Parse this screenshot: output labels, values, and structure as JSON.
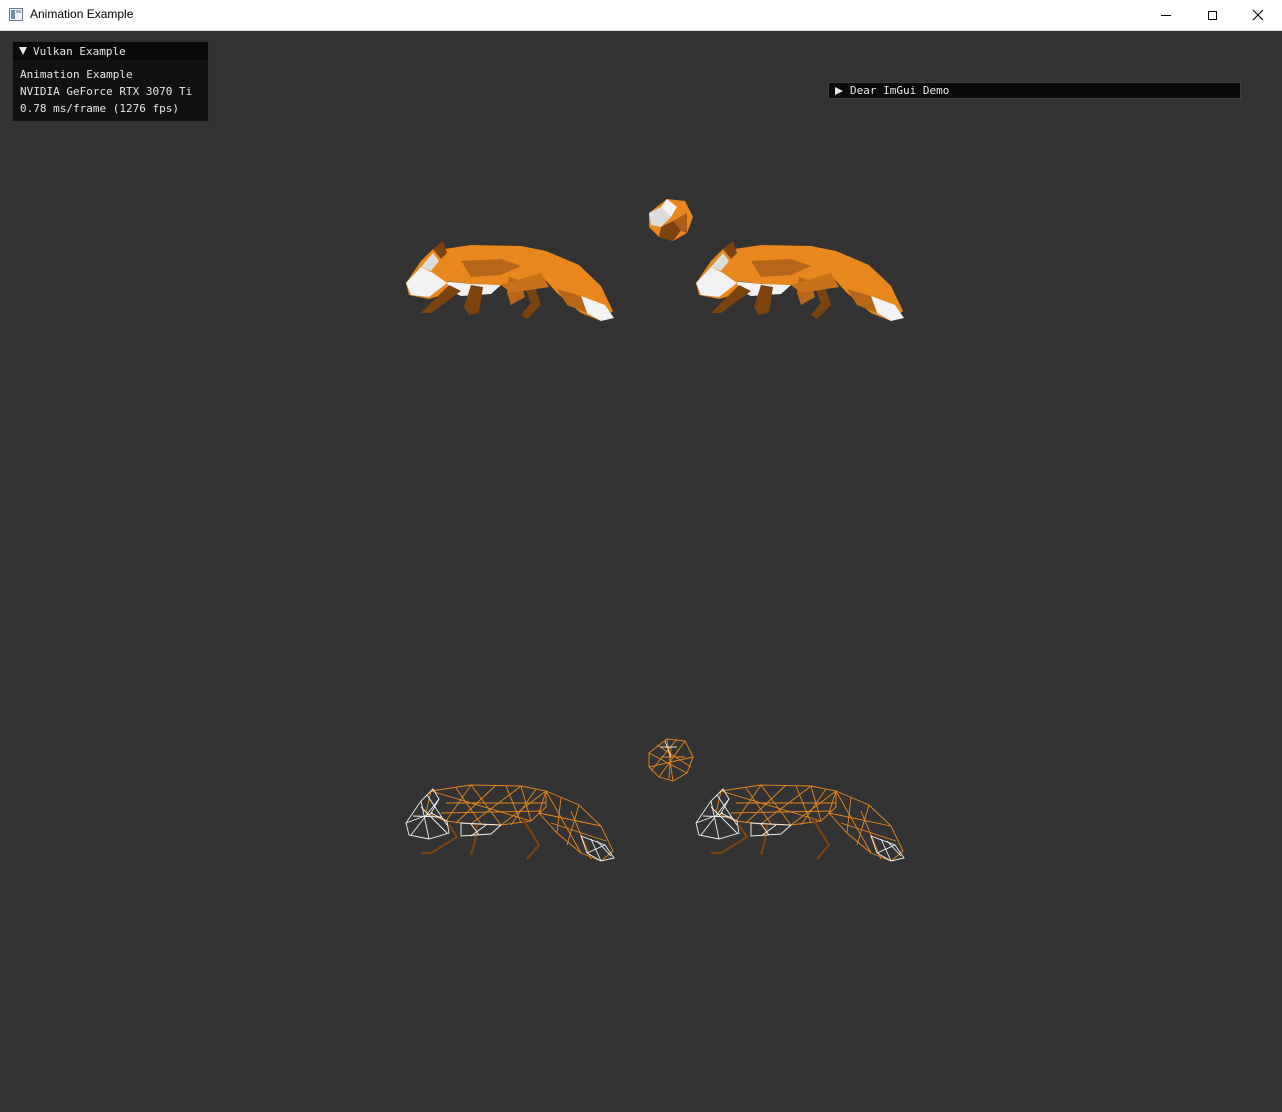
{
  "window": {
    "title": "Animation Example",
    "app_icon": "app-window-icon",
    "buttons": {
      "minimize_icon": "minimize-icon",
      "maximize_icon": "maximize-icon",
      "close_icon": "close-icon"
    }
  },
  "overlay": {
    "header": "Vulkan Example",
    "lines": [
      "Animation Example",
      "NVIDIA GeForce RTX 3070 Ti",
      "0.78 ms/frame (1276 fps)"
    ]
  },
  "demo_window": {
    "header": "Dear ImGui Demo",
    "collapsed": true
  },
  "scene": {
    "background": "#333333",
    "fox_colors": {
      "orange": "#e8871e",
      "dark": "#7a4310",
      "white": "#f2f2f2",
      "shade": "#b8661a"
    },
    "solid_foxes": [
      "fox-solid-left",
      "fox-solid-front",
      "fox-solid-right"
    ],
    "wireframe_foxes": [
      "fox-wireframe-left",
      "fox-wireframe-front",
      "fox-wireframe-right"
    ]
  }
}
